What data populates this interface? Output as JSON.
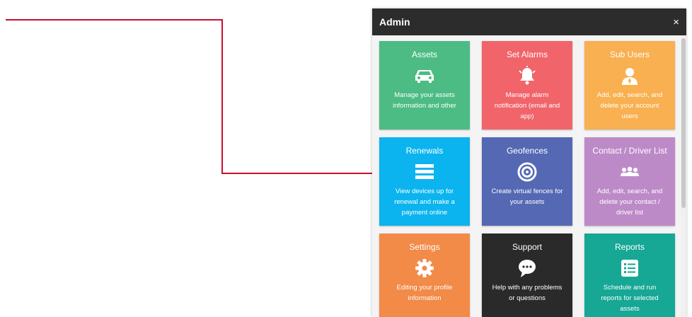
{
  "panel": {
    "title": "Admin",
    "close_label": "×"
  },
  "tiles": [
    {
      "title": "Assets",
      "description": "Manage your assets information and other",
      "icon": "car-icon",
      "color": "#4cbc84"
    },
    {
      "title": "Set Alarms",
      "description": "Manage alarm notification (email and app)",
      "icon": "bell-icon",
      "color": "#f0646a"
    },
    {
      "title": "Sub Users",
      "description": "Add, edit, search, and delete your account users",
      "icon": "user-icon",
      "color": "#f8b050"
    },
    {
      "title": "Renewals",
      "description": "View devices up for renewal and make a payment online",
      "icon": "list-icon",
      "color": "#0bb4ef"
    },
    {
      "title": "Geofences",
      "description": "Create virtual fences for your assets",
      "icon": "geofence-target-icon",
      "color": "#5468b4"
    },
    {
      "title": "Contact / Driver List",
      "description": "Add, edit, search, and delete your contact / driver list",
      "icon": "group-icon",
      "color": "#bd8ac8"
    },
    {
      "title": "Settings",
      "description": "Editing your profile information",
      "icon": "gear-icon",
      "color": "#f28a48"
    },
    {
      "title": "Support",
      "description": "Help with any problems or questions",
      "icon": "chat-bubble-icon",
      "color": "#2a2a2a"
    },
    {
      "title": "Reports",
      "description": "Schedule and run reports for selected assets",
      "icon": "report-list-icon",
      "color": "#16a795"
    }
  ],
  "annotation": {
    "arrow_color": "#c8102e"
  }
}
